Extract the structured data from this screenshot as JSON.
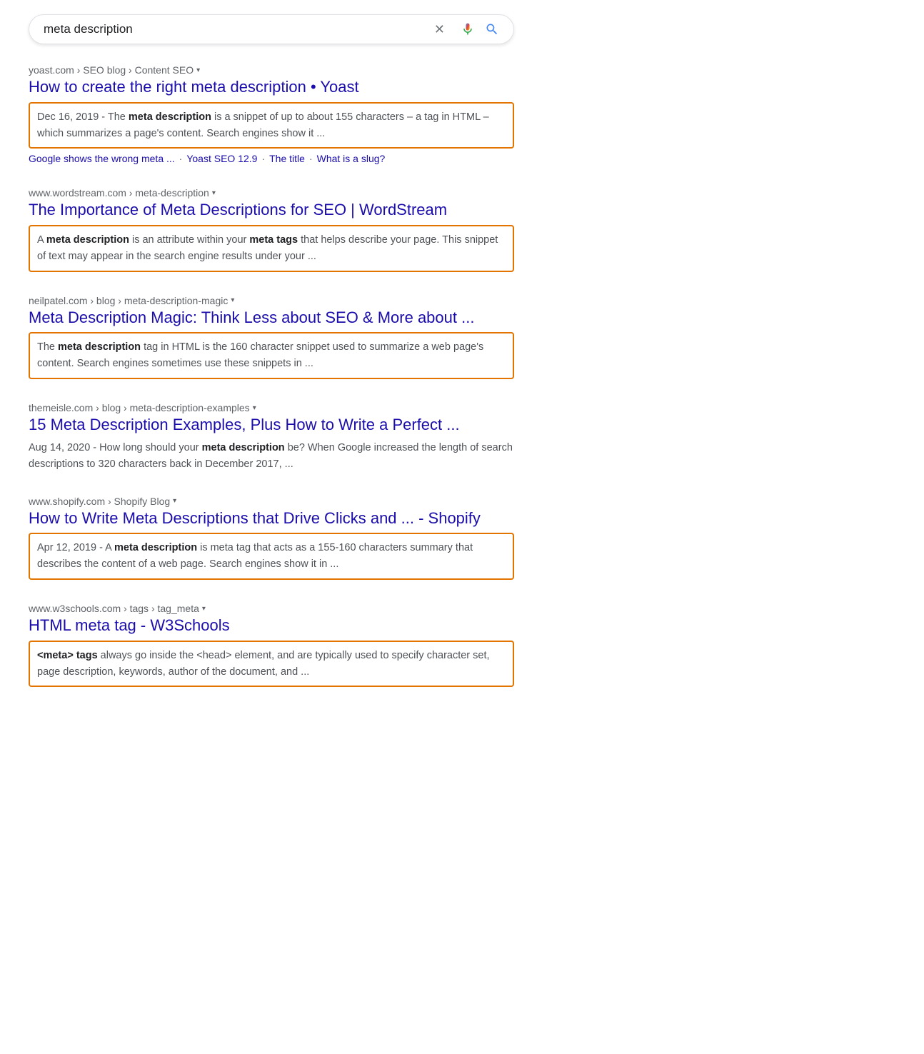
{
  "searchbar": {
    "query": "meta description",
    "clear_label": "×",
    "mic_label": "Search by voice",
    "search_label": "Google Search"
  },
  "results": [
    {
      "id": "result-1",
      "url_parts": [
        "yoast.com",
        "SEO blog",
        "Content SEO"
      ],
      "title": "How to create the right meta description • Yoast",
      "snippet_highlighted": true,
      "snippet_html": "Dec 16, 2019 - The <b>meta description</b> is a snippet of up to about 155 characters – a tag in HTML – which summarizes a page's content. Search engines show it ...",
      "links": [
        {
          "label": "Google shows the wrong meta ...",
          "sep": "·"
        },
        {
          "label": "Yoast SEO 12.9",
          "sep": "·"
        },
        {
          "label": "The title",
          "sep": "·"
        },
        {
          "label": "What is a slug?",
          "sep": ""
        }
      ]
    },
    {
      "id": "result-2",
      "url_parts": [
        "www.wordstream.com",
        "meta-description"
      ],
      "title": "The Importance of Meta Descriptions for SEO | WordStream",
      "snippet_highlighted": true,
      "snippet_html": "A <b>meta description</b> is an attribute within your <b>meta tags</b> that helps describe your page. This snippet of text may appear in the search engine results under your ...",
      "links": []
    },
    {
      "id": "result-3",
      "url_parts": [
        "neilpatel.com",
        "blog",
        "meta-description-magic"
      ],
      "title": "Meta Description Magic: Think Less about SEO & More about ...",
      "snippet_highlighted": true,
      "snippet_html": "The <b>meta description</b> tag in HTML is the 160 character snippet used to summarize a web page's content. Search engines sometimes use these snippets in ...",
      "links": []
    },
    {
      "id": "result-4",
      "url_parts": [
        "themeisle.com",
        "blog",
        "meta-description-examples"
      ],
      "title": "15 Meta Description Examples, Plus How to Write a Perfect ...",
      "snippet_highlighted": false,
      "snippet_html": "Aug 14, 2020 - How long should your <b>meta description</b> be? When Google increased the length of search descriptions to 320 characters back in December 2017, ...",
      "links": []
    },
    {
      "id": "result-5",
      "url_parts": [
        "www.shopify.com",
        "Shopify Blog"
      ],
      "title": "How to Write Meta Descriptions that Drive Clicks and ... - Shopify",
      "snippet_highlighted": true,
      "snippet_html": "Apr 12, 2019 - A <b>meta description</b> is meta tag that acts as a 155-160 characters summary that describes the content of a web page. Search engines show it in ...",
      "links": []
    },
    {
      "id": "result-6",
      "url_parts": [
        "www.w3schools.com",
        "tags",
        "tag_meta"
      ],
      "title": "HTML meta tag - W3Schools",
      "snippet_highlighted": true,
      "snippet_html": "<b>&lt;meta&gt; tags</b> always go inside the &lt;head&gt; element, and are typically used to specify character set, page description, keywords, author of the document, and ...",
      "links": []
    }
  ]
}
